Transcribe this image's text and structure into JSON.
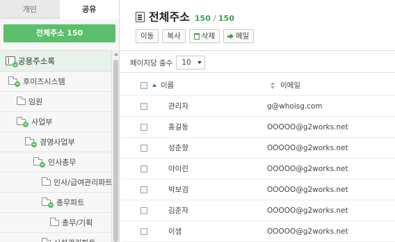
{
  "tabs": {
    "personal": "개인",
    "shared": "공유"
  },
  "count_button": "전체주소 150",
  "tree": {
    "root": "공용주소록",
    "nodes": [
      {
        "label": "후이즈시스템",
        "depth": 0,
        "expanded": true
      },
      {
        "label": "임원",
        "depth": 1,
        "expanded": false
      },
      {
        "label": "사업부",
        "depth": 1,
        "expanded": true
      },
      {
        "label": "경영사업부",
        "depth": 2,
        "expanded": true
      },
      {
        "label": "인사총무",
        "depth": 3,
        "expanded": true
      },
      {
        "label": "인사/급여관리파트",
        "depth": 4,
        "expanded": false
      },
      {
        "label": "총무파트",
        "depth": 4,
        "expanded": true
      },
      {
        "label": "총무/기획",
        "depth": 5,
        "expanded": false
      },
      {
        "label": "시설관리파트",
        "depth": 4,
        "expanded": false
      }
    ]
  },
  "header": {
    "title": "전체주소",
    "count_current": "150",
    "count_total": "150"
  },
  "toolbar": {
    "move": "이동",
    "copy": "복사",
    "delete": "삭제",
    "mail": "메일"
  },
  "per_page": {
    "label": "페이지당 출수",
    "value": "10"
  },
  "table": {
    "col_name": "이름",
    "col_email": "이메일",
    "rows": [
      {
        "name": "관리자",
        "email": "g@whoisg.com"
      },
      {
        "name": "홍길동",
        "email": "OOOOO@g2works.net"
      },
      {
        "name": "성춘향",
        "email": "OOOOO@g2works.net"
      },
      {
        "name": "아이린",
        "email": "OOOOO@g2works.net"
      },
      {
        "name": "박보검",
        "email": "OOOOO@g2works.net"
      },
      {
        "name": "김춘자",
        "email": "OOOOO@g2works.net"
      },
      {
        "name": "이샘",
        "email": "OOOOO@g2works.net"
      }
    ]
  },
  "colors": {
    "accent": "#5cbf6a",
    "count_green": "#3aa04d",
    "sort_blue": "#3a6fd0"
  }
}
